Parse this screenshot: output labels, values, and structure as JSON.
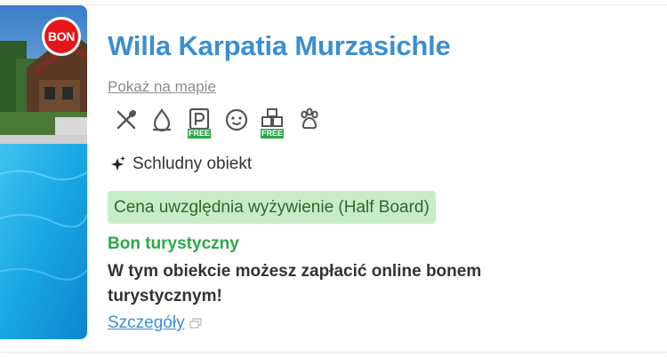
{
  "badge": {
    "label": "BON",
    "color": "#e3161b"
  },
  "hotel": {
    "name": "Willa Karpatia Murzasichle",
    "map_link": "Pokaż na mapie"
  },
  "amenities": [
    {
      "icon": "utensils-icon",
      "free": false
    },
    {
      "icon": "water-drop-icon",
      "free": false
    },
    {
      "icon": "parking-icon",
      "free": true,
      "free_label": "FREE"
    },
    {
      "icon": "baby-face-icon",
      "free": false
    },
    {
      "icon": "kids-play-icon",
      "free": true,
      "free_label": "FREE"
    },
    {
      "icon": "paw-icon",
      "free": false
    }
  ],
  "feature": {
    "icon": "sparkle-icon",
    "label": "Schludny obiekt"
  },
  "meal": {
    "label": "Cena uwzględnia wyżywienie (Half Board)"
  },
  "tourist_voucher": {
    "title": "Bon turystyczny",
    "text": "W tym obiekcie możesz zapłacić online bonem turystycznym!",
    "details_link": "Szczegóły"
  },
  "colors": {
    "title": "#3b8fd0",
    "green": "#2aa84a",
    "meal_bg": "#c8ecc8"
  }
}
